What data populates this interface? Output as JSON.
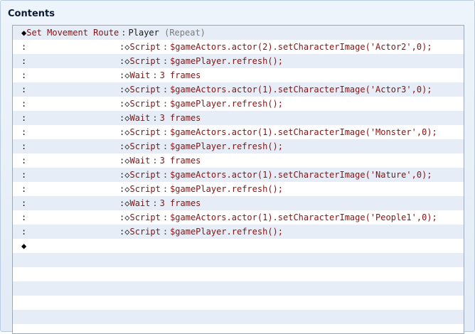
{
  "panel": {
    "title": "Contents"
  },
  "header_row": {
    "command": "Set Movement Route",
    "separator": ":",
    "target": "Player",
    "option": "(Repeat)"
  },
  "commands": [
    {
      "type": "Script",
      "arg": "$gameActors.actor(2).setCharacterImage('Actor2',0);"
    },
    {
      "type": "Script",
      "arg": "$gamePlayer.refresh();"
    },
    {
      "type": "Wait",
      "arg": "3 frames"
    },
    {
      "type": "Script",
      "arg": "$gameActors.actor(1).setCharacterImage('Actor3',0);"
    },
    {
      "type": "Script",
      "arg": "$gamePlayer.refresh();"
    },
    {
      "type": "Wait",
      "arg": "3 frames"
    },
    {
      "type": "Script",
      "arg": "$gameActors.actor(1).setCharacterImage('Monster',0);"
    },
    {
      "type": "Script",
      "arg": "$gamePlayer.refresh();"
    },
    {
      "type": "Wait",
      "arg": "3 frames"
    },
    {
      "type": "Script",
      "arg": "$gameActors.actor(1).setCharacterImage('Nature',0);"
    },
    {
      "type": "Script",
      "arg": "$gamePlayer.refresh();"
    },
    {
      "type": "Wait",
      "arg": "3 frames"
    },
    {
      "type": "Script",
      "arg": "$gameActors.actor(1).setCharacterImage('People1',0);"
    },
    {
      "type": "Script",
      "arg": "$gamePlayer.refresh();"
    }
  ],
  "glyphs": {
    "filled_diamond": "◆",
    "open_diamond": "◇",
    "colon": ":"
  }
}
